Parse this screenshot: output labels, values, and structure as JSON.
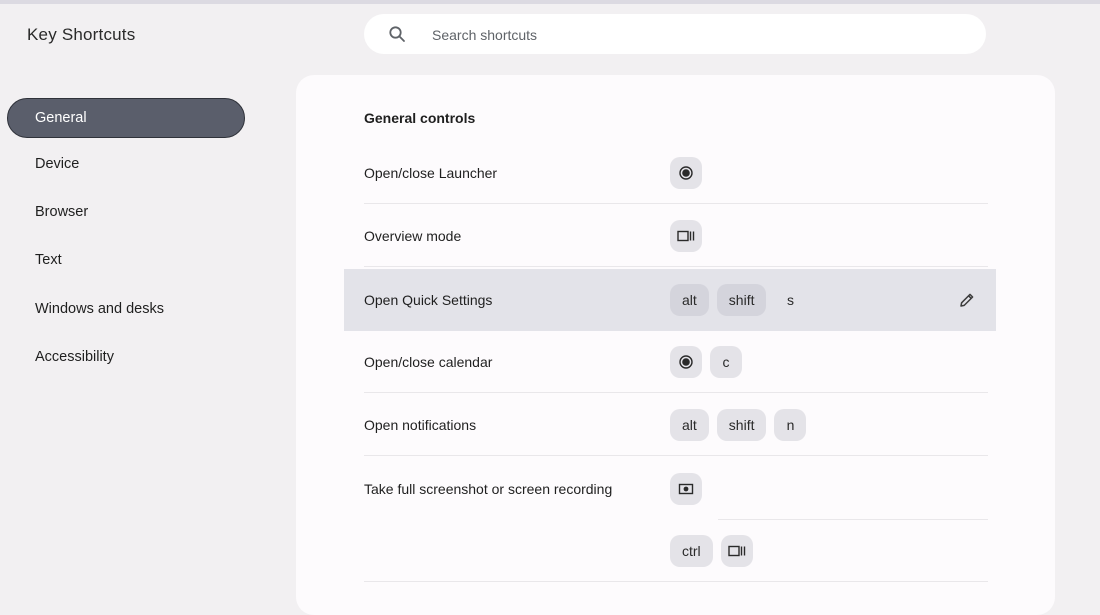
{
  "app": {
    "title": "Key Shortcuts"
  },
  "search": {
    "placeholder": "Search shortcuts",
    "value": ""
  },
  "sidebar": {
    "items": [
      {
        "label": "General",
        "active": true
      },
      {
        "label": "Device"
      },
      {
        "label": "Browser"
      },
      {
        "label": "Text"
      },
      {
        "label": "Windows and desks"
      },
      {
        "label": "Accessibility"
      }
    ]
  },
  "main": {
    "section_title": "General controls",
    "shortcuts": [
      {
        "label": "Open/close Launcher",
        "keys": [
          "launcher-icon"
        ]
      },
      {
        "label": "Overview mode",
        "keys": [
          "overview-icon"
        ]
      },
      {
        "label": "Open Quick Settings",
        "keys": [
          "alt",
          "shift",
          "s"
        ],
        "highlighted": true
      },
      {
        "label": "Open/close calendar",
        "keys": [
          "launcher-icon",
          "c"
        ]
      },
      {
        "label": "Open notifications",
        "keys": [
          "alt",
          "shift",
          "n"
        ]
      },
      {
        "label": "Take full screenshot or screen recording",
        "keys": [
          "screenshot-icon"
        ]
      },
      {
        "label": "",
        "keys": [
          "ctrl",
          "overview-icon"
        ]
      }
    ]
  },
  "colors": {
    "accent": "#5a5e6b",
    "highlight_row": "#e3e3e9",
    "key_bg": "#e4e3e8"
  }
}
